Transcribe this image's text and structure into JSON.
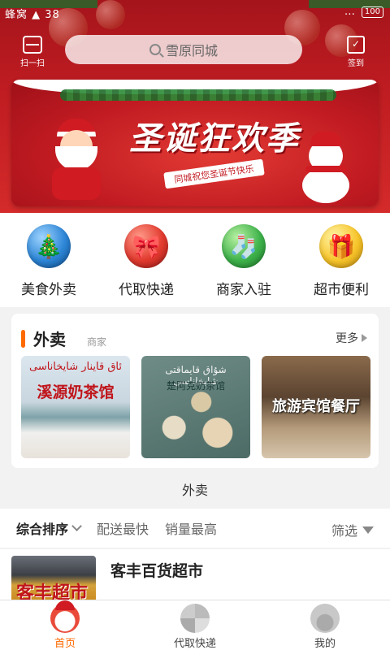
{
  "status_bar": {
    "left": "蜂窝 ▲ 38",
    "right_signal": "…",
    "battery": "100"
  },
  "header": {
    "scan_label": "扫一扫",
    "search_placeholder": "雪原同城",
    "signin_label": "签到"
  },
  "banner": {
    "title": "圣诞狂欢季",
    "ribbon": "同城祝您圣诞节快乐"
  },
  "quick_nav": [
    {
      "label": "美食外卖",
      "icon": "christmas-tree-icon",
      "glyph": "🎄"
    },
    {
      "label": "代取快递",
      "icon": "gift-bow-icon",
      "glyph": "🎀"
    },
    {
      "label": "商家入驻",
      "icon": "christmas-stocking-icon",
      "glyph": "🧦"
    },
    {
      "label": "超市便利",
      "icon": "candy-cane-icon",
      "glyph": "🎁"
    }
  ],
  "takeaway_card": {
    "title": "外卖",
    "subtitle": "商家",
    "more": "更多",
    "shops": [
      {
        "overlay_top": "ئاق قاينار شايخاناسى",
        "overlay_main": "溪源奶茶馆"
      },
      {
        "overlay_top": "شۇاق قايماقتى شايخاناسى",
        "overlay_main": "楚阿克奶茶馆"
      },
      {
        "overlay_top": "",
        "overlay_main": "旅游宾馆餐厅"
      }
    ]
  },
  "section_caption": "外卖",
  "sort_bar": {
    "options": [
      "综合排序",
      "配送最快",
      "销量最高"
    ],
    "filter": "筛选"
  },
  "store": {
    "name": "客丰百货超市",
    "sign": "客丰超市"
  },
  "tabbar": [
    {
      "label": "首页",
      "active": true
    },
    {
      "label": "代取快递",
      "active": false
    },
    {
      "label": "我的",
      "active": false
    }
  ],
  "colors": {
    "accent": "#ff6a00",
    "header_red": "#c01d22"
  }
}
